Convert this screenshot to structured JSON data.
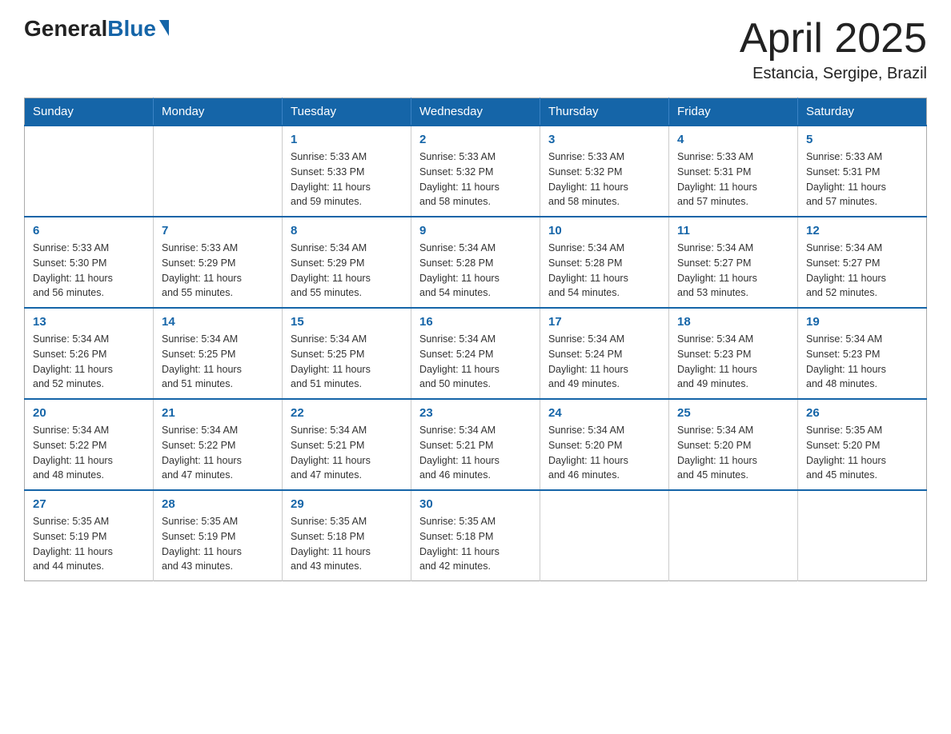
{
  "logo": {
    "general": "General",
    "blue": "Blue"
  },
  "header": {
    "title": "April 2025",
    "subtitle": "Estancia, Sergipe, Brazil"
  },
  "days_of_week": [
    "Sunday",
    "Monday",
    "Tuesday",
    "Wednesday",
    "Thursday",
    "Friday",
    "Saturday"
  ],
  "weeks": [
    [
      {
        "day": "",
        "info": ""
      },
      {
        "day": "",
        "info": ""
      },
      {
        "day": "1",
        "info": "Sunrise: 5:33 AM\nSunset: 5:33 PM\nDaylight: 11 hours\nand 59 minutes."
      },
      {
        "day": "2",
        "info": "Sunrise: 5:33 AM\nSunset: 5:32 PM\nDaylight: 11 hours\nand 58 minutes."
      },
      {
        "day": "3",
        "info": "Sunrise: 5:33 AM\nSunset: 5:32 PM\nDaylight: 11 hours\nand 58 minutes."
      },
      {
        "day": "4",
        "info": "Sunrise: 5:33 AM\nSunset: 5:31 PM\nDaylight: 11 hours\nand 57 minutes."
      },
      {
        "day": "5",
        "info": "Sunrise: 5:33 AM\nSunset: 5:31 PM\nDaylight: 11 hours\nand 57 minutes."
      }
    ],
    [
      {
        "day": "6",
        "info": "Sunrise: 5:33 AM\nSunset: 5:30 PM\nDaylight: 11 hours\nand 56 minutes."
      },
      {
        "day": "7",
        "info": "Sunrise: 5:33 AM\nSunset: 5:29 PM\nDaylight: 11 hours\nand 55 minutes."
      },
      {
        "day": "8",
        "info": "Sunrise: 5:34 AM\nSunset: 5:29 PM\nDaylight: 11 hours\nand 55 minutes."
      },
      {
        "day": "9",
        "info": "Sunrise: 5:34 AM\nSunset: 5:28 PM\nDaylight: 11 hours\nand 54 minutes."
      },
      {
        "day": "10",
        "info": "Sunrise: 5:34 AM\nSunset: 5:28 PM\nDaylight: 11 hours\nand 54 minutes."
      },
      {
        "day": "11",
        "info": "Sunrise: 5:34 AM\nSunset: 5:27 PM\nDaylight: 11 hours\nand 53 minutes."
      },
      {
        "day": "12",
        "info": "Sunrise: 5:34 AM\nSunset: 5:27 PM\nDaylight: 11 hours\nand 52 minutes."
      }
    ],
    [
      {
        "day": "13",
        "info": "Sunrise: 5:34 AM\nSunset: 5:26 PM\nDaylight: 11 hours\nand 52 minutes."
      },
      {
        "day": "14",
        "info": "Sunrise: 5:34 AM\nSunset: 5:25 PM\nDaylight: 11 hours\nand 51 minutes."
      },
      {
        "day": "15",
        "info": "Sunrise: 5:34 AM\nSunset: 5:25 PM\nDaylight: 11 hours\nand 51 minutes."
      },
      {
        "day": "16",
        "info": "Sunrise: 5:34 AM\nSunset: 5:24 PM\nDaylight: 11 hours\nand 50 minutes."
      },
      {
        "day": "17",
        "info": "Sunrise: 5:34 AM\nSunset: 5:24 PM\nDaylight: 11 hours\nand 49 minutes."
      },
      {
        "day": "18",
        "info": "Sunrise: 5:34 AM\nSunset: 5:23 PM\nDaylight: 11 hours\nand 49 minutes."
      },
      {
        "day": "19",
        "info": "Sunrise: 5:34 AM\nSunset: 5:23 PM\nDaylight: 11 hours\nand 48 minutes."
      }
    ],
    [
      {
        "day": "20",
        "info": "Sunrise: 5:34 AM\nSunset: 5:22 PM\nDaylight: 11 hours\nand 48 minutes."
      },
      {
        "day": "21",
        "info": "Sunrise: 5:34 AM\nSunset: 5:22 PM\nDaylight: 11 hours\nand 47 minutes."
      },
      {
        "day": "22",
        "info": "Sunrise: 5:34 AM\nSunset: 5:21 PM\nDaylight: 11 hours\nand 47 minutes."
      },
      {
        "day": "23",
        "info": "Sunrise: 5:34 AM\nSunset: 5:21 PM\nDaylight: 11 hours\nand 46 minutes."
      },
      {
        "day": "24",
        "info": "Sunrise: 5:34 AM\nSunset: 5:20 PM\nDaylight: 11 hours\nand 46 minutes."
      },
      {
        "day": "25",
        "info": "Sunrise: 5:34 AM\nSunset: 5:20 PM\nDaylight: 11 hours\nand 45 minutes."
      },
      {
        "day": "26",
        "info": "Sunrise: 5:35 AM\nSunset: 5:20 PM\nDaylight: 11 hours\nand 45 minutes."
      }
    ],
    [
      {
        "day": "27",
        "info": "Sunrise: 5:35 AM\nSunset: 5:19 PM\nDaylight: 11 hours\nand 44 minutes."
      },
      {
        "day": "28",
        "info": "Sunrise: 5:35 AM\nSunset: 5:19 PM\nDaylight: 11 hours\nand 43 minutes."
      },
      {
        "day": "29",
        "info": "Sunrise: 5:35 AM\nSunset: 5:18 PM\nDaylight: 11 hours\nand 43 minutes."
      },
      {
        "day": "30",
        "info": "Sunrise: 5:35 AM\nSunset: 5:18 PM\nDaylight: 11 hours\nand 42 minutes."
      },
      {
        "day": "",
        "info": ""
      },
      {
        "day": "",
        "info": ""
      },
      {
        "day": "",
        "info": ""
      }
    ]
  ]
}
